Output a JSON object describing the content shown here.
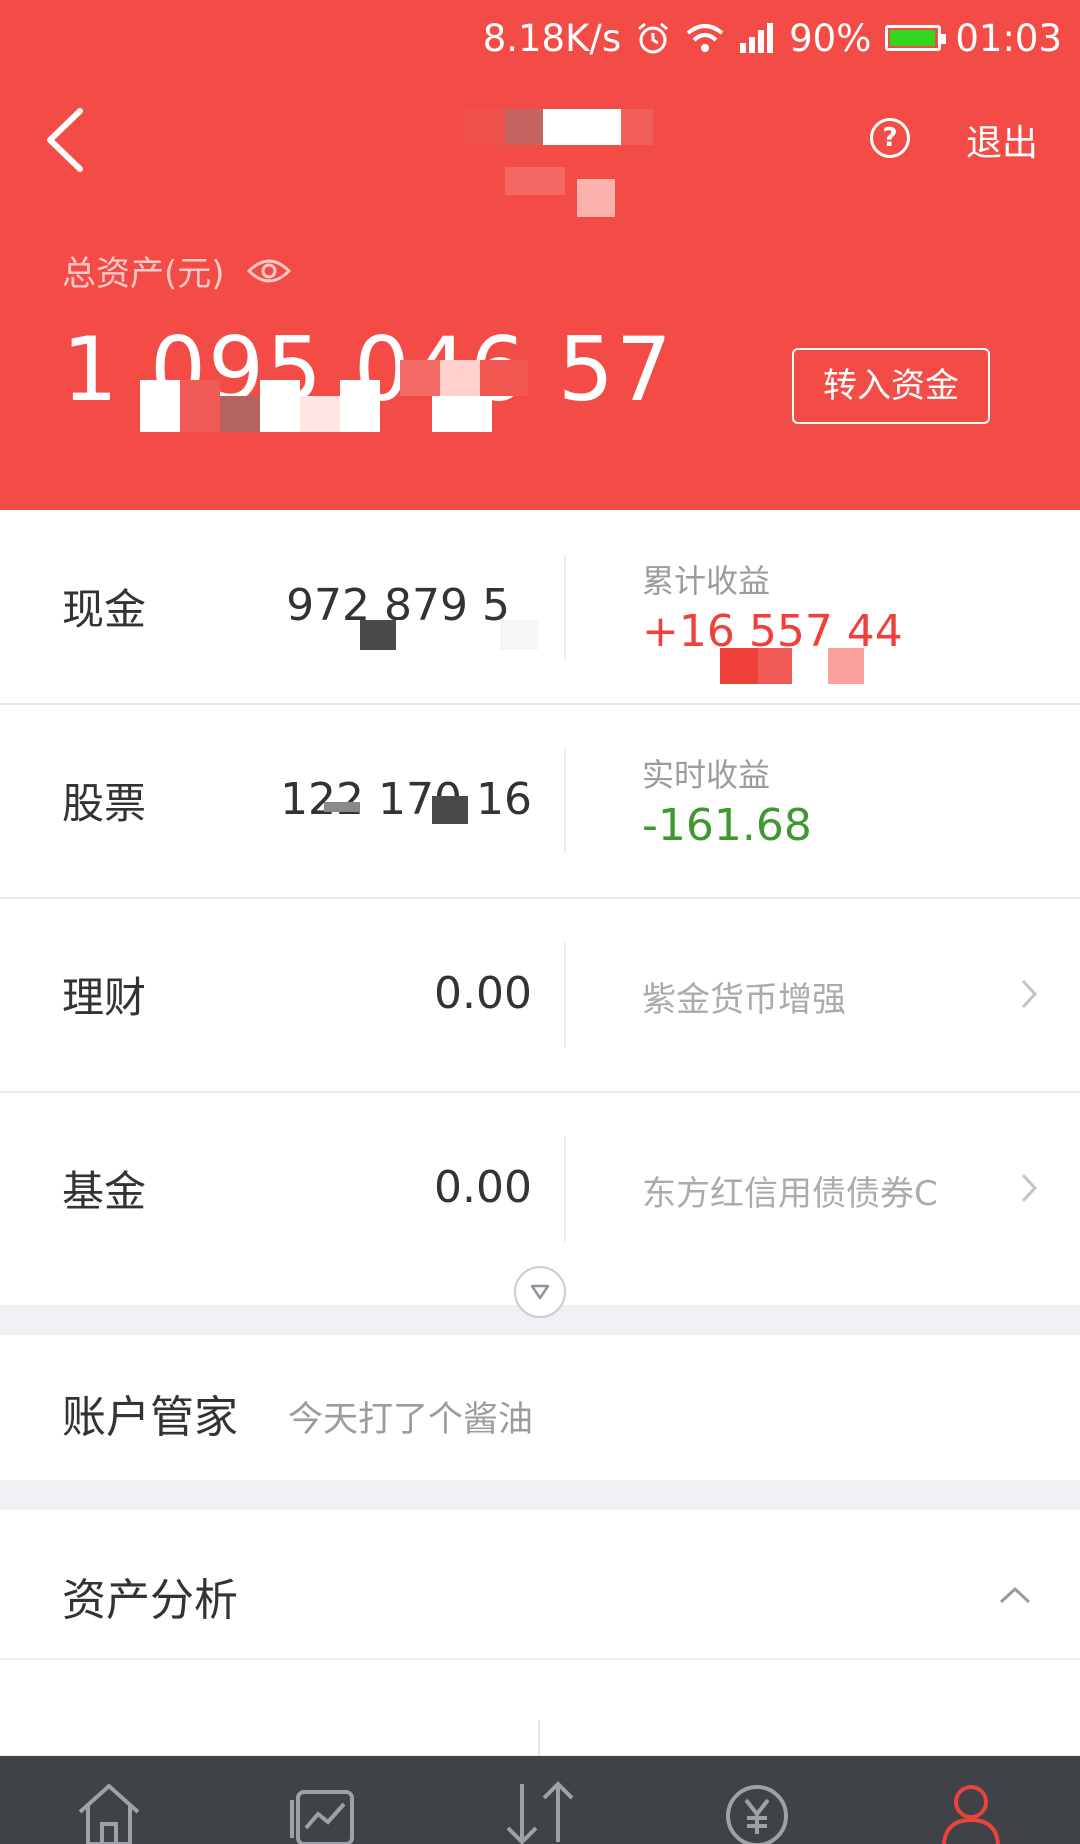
{
  "statusbar": {
    "network_speed": "8.18K/s",
    "battery_percent": "90%",
    "battery_level": 0.9,
    "time": "01:03",
    "icons": [
      "alarm-icon",
      "wifi-icon",
      "signal-icon",
      "battery-icon"
    ]
  },
  "header": {
    "logout_label": "退出",
    "help_glyph": "?"
  },
  "total_assets": {
    "label": "总资产(元)",
    "value_visible": "1 095 046 57",
    "transfer_button": "转入资金"
  },
  "rows": [
    {
      "name": "现金",
      "value": "972 879 5",
      "side_label": "累计收益",
      "side_value": "+16 557 44"
    },
    {
      "name": "股票",
      "value": "122 170 16",
      "side_label": "实时收益",
      "side_value": "-161.68"
    },
    {
      "name": "理财",
      "value": "0.00",
      "product": "紫金货币增强"
    },
    {
      "name": "基金",
      "value": "0.00",
      "product": "东方红信用债债券C"
    }
  ],
  "manager": {
    "title": "账户管家",
    "description": "今天打了个酱油"
  },
  "analysis": {
    "title": "资产分析"
  },
  "colors": {
    "header_red": "#f34c46",
    "profit_red": "#f0403a",
    "loss_green": "#3e9a2f",
    "nav_bg": "#3f4246",
    "nav_active": "#e9433d"
  },
  "nav": {
    "items": [
      "home-icon",
      "market-icon",
      "trade-icon",
      "finance-icon",
      "account-icon"
    ],
    "active": "account-icon"
  }
}
